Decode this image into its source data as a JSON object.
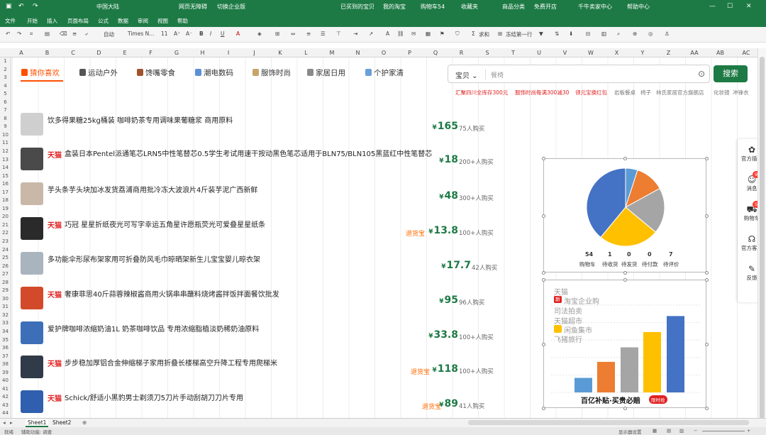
{
  "titlebar": {
    "region": "中国大陆",
    "items": [
      "网页无障碍",
      "切换企业版",
      "已买到的宝贝",
      "我的淘宝",
      "购物车54",
      "收藏夹",
      "商品分类",
      "免费开店",
      "千牛卖家中心",
      "帮助中心"
    ]
  },
  "ribbon_tabs": [
    "文件",
    "开始",
    "插入",
    "页面布局",
    "公式",
    "数据",
    "审阅",
    "视图",
    "帮助"
  ],
  "toolbar": {
    "font_size_label": "自动",
    "font_name": "Times N...",
    "font_size": "11",
    "sum_label": "求和",
    "filter_label": "冻结第一行"
  },
  "columns": [
    "A",
    "B",
    "C",
    "D",
    "E",
    "F",
    "G",
    "H",
    "I",
    "J",
    "K",
    "L",
    "M",
    "N",
    "O",
    "P",
    "Q",
    "R",
    "S",
    "T",
    "U",
    "V",
    "W",
    "X",
    "Y",
    "Z",
    "AA",
    "AB",
    "AC"
  ],
  "rows": [
    "1",
    "2",
    "3",
    "4",
    "5",
    "6",
    "7",
    "8",
    "9",
    "10",
    "11",
    "12",
    "13",
    "14",
    "15",
    "16",
    "17",
    "18",
    "19",
    "20",
    "21",
    "22",
    "23",
    "24",
    "25",
    "26",
    "27",
    "28",
    "29",
    "30",
    "31",
    "32",
    "33",
    "34",
    "35",
    "36",
    "37",
    "38",
    "39",
    "40",
    "41",
    "42",
    "43",
    "44"
  ],
  "categories": [
    {
      "label": "猜你喜欢",
      "active": true,
      "icon_color": "#ff5000"
    },
    {
      "label": "运动户外",
      "active": false,
      "icon_color": "#555555"
    },
    {
      "label": "馋嘴零食",
      "active": false,
      "icon_color": "#a0522d"
    },
    {
      "label": "潮电数码",
      "active": false,
      "icon_color": "#5b8fd6"
    },
    {
      "label": "服饰时尚",
      "active": false,
      "icon_color": "#c8a46a"
    },
    {
      "label": "家居日用",
      "active": false,
      "icon_color": "#8a8a8a"
    },
    {
      "label": "个护家清",
      "active": false,
      "icon_color": "#6aa0d8"
    }
  ],
  "search": {
    "scope": "宝贝",
    "placeholder": "餐椅",
    "button": "搜索",
    "hot": [
      {
        "text": "汇聚四川全库存300元",
        "red": true
      },
      {
        "text": "服饰时尚每满300减30",
        "red": true
      },
      {
        "text": "领元宝换红包",
        "red": true
      },
      {
        "text": "岩板餐桌",
        "red": false
      },
      {
        "text": "椅子",
        "red": false
      },
      {
        "text": "林氏家居官方旗舰店",
        "red": false
      },
      {
        "text": "化妆镜",
        "red": false
      },
      {
        "text": "冲锋衣",
        "red": false
      }
    ]
  },
  "products": [
    {
      "tmall": false,
      "title": "饮多得果糖25kg桶装 咖啡奶茶专用调味果葡糖浆 商用原料",
      "badge": "",
      "price": "165",
      "buyers": "75人购买",
      "thumb": "#cfcfcf"
    },
    {
      "tmall": true,
      "title": "盒装日本Pentel派通笔芯LRN5中性笔替芯0.5学生考试用速干按动黑色笔芯适用于BLN75/BLN105黑蓝红中性笔替芯",
      "badge": "",
      "price": "18",
      "buyers": "200+人购买",
      "thumb": "#4a4a4a"
    },
    {
      "tmall": false,
      "title": "芋头条芋头块加冰发货荔浦商用批冷冻大波浪片4斤装芋泥广西新鲜",
      "badge": "",
      "price": "48",
      "buyers": "300+人购买",
      "thumb": "#c9b8a8"
    },
    {
      "tmall": true,
      "title": "巧冠 星星折纸夜光可写字幸运五角星许愿瓶荧光可爱叠星星纸条",
      "badge": "退货宝",
      "price": "13.8",
      "buyers": "100+人购买",
      "thumb": "#2a2a2a"
    },
    {
      "tmall": false,
      "title": "多功能伞形尿布架家用可折叠防风毛巾晾晒架新生儿宝宝婴儿晾衣架",
      "badge": "",
      "price": "17.7",
      "buyers": "42人购买",
      "thumb": "#a9b4bf"
    },
    {
      "tmall": true,
      "title": "奢康菲思40斤蒜蓉辣椒酱商用火锅串串蘸料烧烤酱拌饭拌面餐饮批发",
      "badge": "",
      "price": "95",
      "buyers": "96人购买",
      "thumb": "#d24a2a"
    },
    {
      "tmall": false,
      "title": "爱护牌咖啡浓缩奶油1L 奶茶咖啡饮品 专用浓缩脂植淡奶稀奶油原料",
      "badge": "",
      "price": "33.8",
      "buyers": "100+人购买",
      "thumb": "#3c6fb8"
    },
    {
      "tmall": true,
      "title": "步步稳加厚铝合金伸缩梯子家用折叠长楼梯高空升降工程专用爬梯米",
      "badge": "退货宝",
      "price": "118",
      "buyers": "100+人购买",
      "thumb": "#303a48"
    },
    {
      "tmall": true,
      "title": "Schick/舒适小黑豹男士剃须刀5刀片手动刮胡刀刀片专用",
      "badge": "退货宝",
      "price": "89",
      "buyers": "41人购买",
      "thumb": "#2f5fae"
    }
  ],
  "pie_chart": {
    "chart_data": {
      "type": "pie",
      "slices": [
        {
          "value": 5,
          "color": "#5b9bd5"
        },
        {
          "value": 12,
          "color": "#ed7d31"
        },
        {
          "value": 19,
          "color": "#a5a5a5"
        },
        {
          "value": 25,
          "color": "#ffc000"
        },
        {
          "value": 39,
          "color": "#4472c4"
        }
      ]
    },
    "stats": [
      {
        "value": "54",
        "label": "购物车"
      },
      {
        "value": "1",
        "label": "待收货"
      },
      {
        "value": "0",
        "label": "待发货"
      },
      {
        "value": "0",
        "label": "待付款"
      },
      {
        "value": "7",
        "label": "待评价"
      }
    ]
  },
  "bar_chart": {
    "overlay_items": [
      "天猫",
      "淘宝企业购",
      "司法拍卖",
      "天猫超市",
      "闲鱼集市",
      "飞猪旅行"
    ],
    "new_tag": "新",
    "footer": "百亿补贴·买贵必赔",
    "footer_badge": "限时抢",
    "chart_data": {
      "type": "bar",
      "values": [
        20,
        42,
        62,
        83,
        105
      ],
      "colors": [
        "#5b9bd5",
        "#ed7d31",
        "#a5a5a5",
        "#ffc000",
        "#4472c4"
      ],
      "ylim": [
        0,
        120
      ]
    }
  },
  "sidebar": [
    {
      "label": "官方插件",
      "icon": "puzzle-icon",
      "glyph": "✿",
      "count": ""
    },
    {
      "label": "消息",
      "icon": "message-icon",
      "glyph": "☺",
      "count": "99+"
    },
    {
      "label": "购物车",
      "icon": "cart-icon",
      "glyph": "⛟",
      "count": "54"
    },
    {
      "label": "官方客服",
      "icon": "headset-icon",
      "glyph": "☊",
      "count": ""
    },
    {
      "label": "反馈",
      "icon": "feedback-icon",
      "glyph": "✎",
      "count": ""
    }
  ],
  "sheets": [
    "Sheet1",
    "Sheet2"
  ],
  "status": {
    "left": "就绪",
    "access": "辅助功能: 调查",
    "display": "显示器设置"
  },
  "theme": {
    "excel_green": "#1d7a45",
    "accent": "#ff5000",
    "price": "#1d7a45"
  }
}
